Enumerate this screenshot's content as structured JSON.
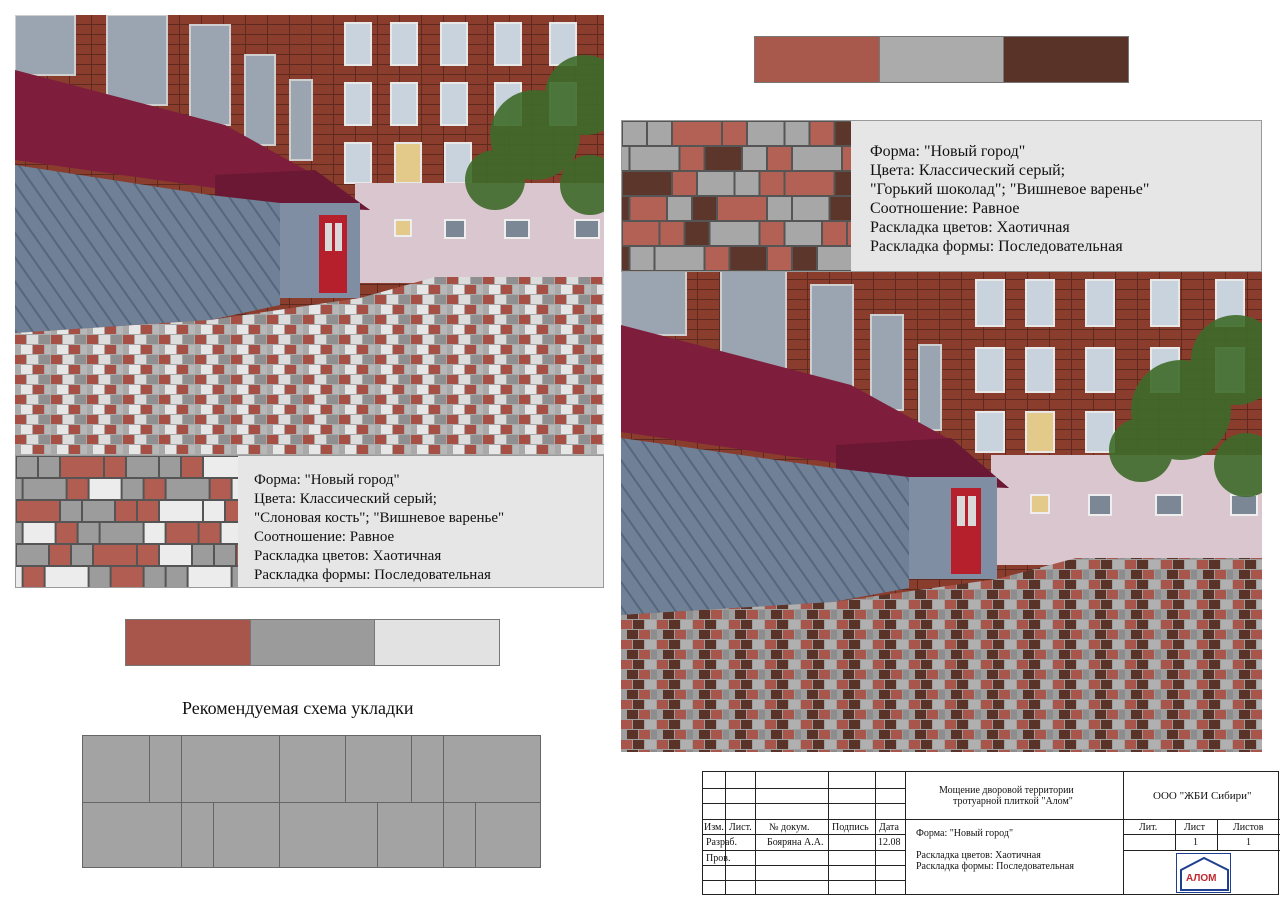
{
  "left_panel": {
    "info_lines": [
      "Форма: \"Новый город\"",
      "Цвета: Классический серый;",
      "\"Слоновая кость\"; \"Вишневое варенье\"",
      "Соотношение: Равное",
      "Раскладка цветов: Хаотичная",
      "Раскладка формы: Последовательная"
    ],
    "swatch_colors": [
      "#a8564b",
      "#9b9b9b",
      "#e2e2e2"
    ],
    "pattern_colors": [
      "#b25d52",
      "#9c9c9c",
      "#ececec"
    ]
  },
  "right_panel": {
    "info_lines": [
      "Форма: \"Новый город\"",
      "Цвета: Классический серый;",
      "\"Горький шоколад\"; \"Вишневое варенье\"",
      "Соотношение: Равное",
      "Раскладка цветов: Хаотичная",
      "Раскладка формы: Последовательная"
    ],
    "swatch_colors": [
      "#a9584c",
      "#ababab",
      "#5a3328"
    ],
    "pattern_colors": [
      "#b46155",
      "#a7a7a7",
      "#5c352b"
    ]
  },
  "scheme": {
    "heading": "Рекомендуемая схема укладки",
    "color": "#a3a3a3"
  },
  "title_block": {
    "project_line1": "Мощение дворовой территории",
    "project_line2": "тротуарной плиткой \"Алом\"",
    "company": "ООО \"ЖБИ Сибири\"",
    "header_izm": "Изм.",
    "header_list": "Лист.",
    "header_doc": "№ докум.",
    "header_sign": "Подпись",
    "header_date": "Дата",
    "row_razrab": "Разраб.",
    "razrab_name": "Бояряна А.А.",
    "razrab_date": "12.08",
    "row_prov": "Пров.",
    "desc_form": "Форма: \"Новый город\"",
    "desc_colors": "Раскладка цветов: Хаотичная",
    "desc_shape": "Раскладка формы: Последовательная",
    "lit_label": "Лит.",
    "sheet_label": "Лист",
    "sheets_label": "Листов",
    "sheet_value": "1",
    "sheets_value": "1",
    "logo_text": "АЛОМ",
    "logo_color": "#1f3f8f"
  }
}
